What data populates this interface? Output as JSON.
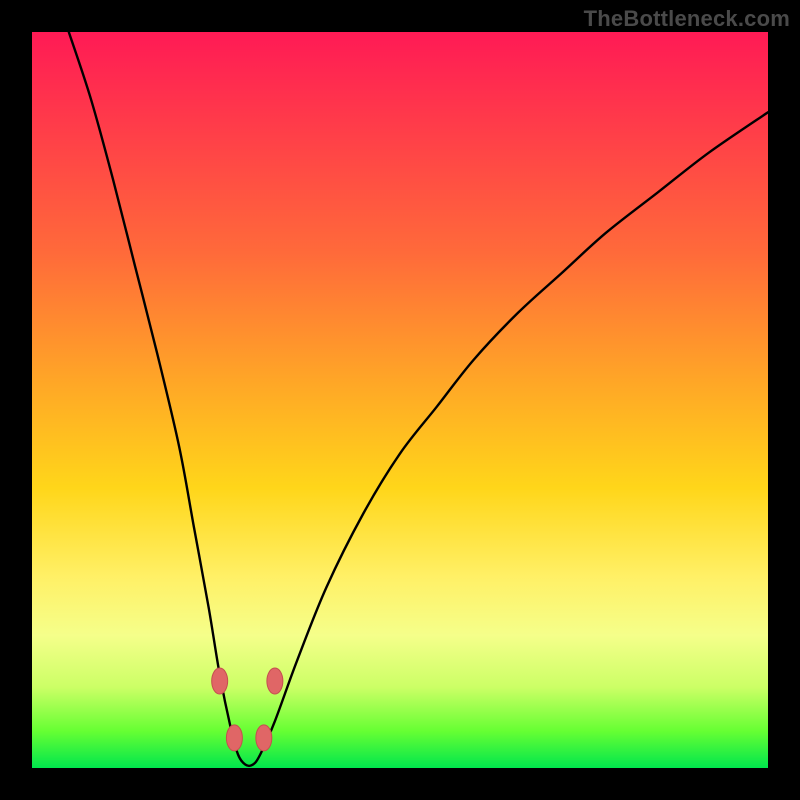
{
  "watermark": "TheBottleneck.com",
  "colors": {
    "frame_bg": "#000000",
    "curve_stroke": "#000000",
    "marker_fill": "#e06666",
    "marker_stroke": "#c44f4f",
    "gradient_stops": [
      "#ff1a55",
      "#ff3a4a",
      "#ff6a3a",
      "#ffa826",
      "#ffd61a",
      "#fff066",
      "#f5ff8a",
      "#ccff66",
      "#66ff33",
      "#00e64d"
    ]
  },
  "chart_data": {
    "type": "line",
    "title": "",
    "xlabel": "",
    "ylabel": "",
    "xlim": [
      0,
      100
    ],
    "ylim": [
      0,
      110
    ],
    "grid": false,
    "legend": false,
    "series": [
      {
        "name": "bottleneck-curve",
        "x": [
          5,
          8,
          11,
          14,
          17,
          20,
          22,
          24,
          25.5,
          27,
          28,
          29,
          30,
          31,
          33,
          36,
          40,
          45,
          50,
          55,
          60,
          66,
          72,
          78,
          85,
          92,
          100
        ],
        "y": [
          110,
          100,
          88,
          75,
          62,
          48,
          36,
          24,
          14,
          6,
          2,
          0.5,
          0.5,
          2,
          7,
          16,
          27,
          38,
          47,
          54,
          61,
          68,
          74,
          80,
          86,
          92,
          98
        ]
      }
    ],
    "curve_min_x": 29.5,
    "markers": [
      {
        "name": "left-upper",
        "x": 25.5,
        "y": 13
      },
      {
        "name": "left-lower",
        "x": 27.5,
        "y": 4.5
      },
      {
        "name": "right-lower",
        "x": 31.5,
        "y": 4.5
      },
      {
        "name": "right-upper",
        "x": 33.0,
        "y": 13
      }
    ]
  }
}
